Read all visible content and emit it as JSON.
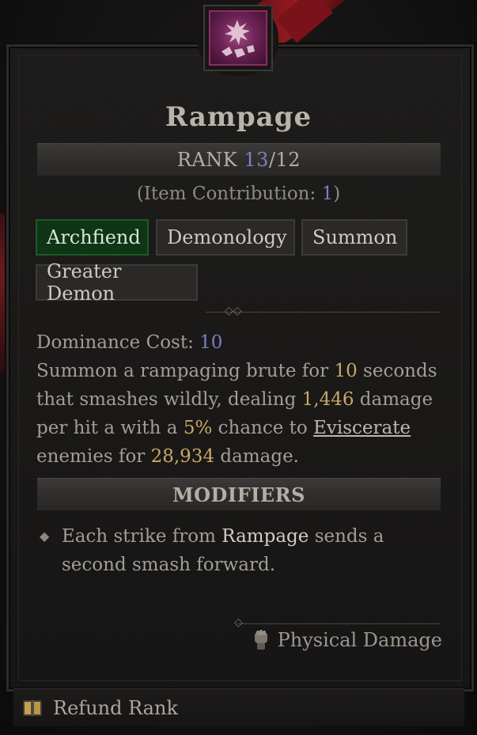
{
  "skill": {
    "name": "Rampage",
    "icon": "rampage-skill-icon",
    "rank_prefix": "RANK",
    "rank_current": "13",
    "rank_separator": "/",
    "rank_max": "12",
    "contribution_prefix": "(Item Contribution: ",
    "contribution_value": "1",
    "contribution_suffix": ")"
  },
  "tags": [
    {
      "label": "Archfiend",
      "active": true
    },
    {
      "label": "Demonology",
      "active": false
    },
    {
      "label": "Summon",
      "active": false
    },
    {
      "label": "Greater Demon",
      "active": false
    }
  ],
  "cost": {
    "label": "Dominance Cost: ",
    "value": "10"
  },
  "description": {
    "p1": "Summon a rampaging brute for ",
    "duration": "10",
    "p2": " seconds that smashes wildly, dealing ",
    "damage": "1,446",
    "p3": " damage per hit a with a ",
    "chance": "5%",
    "p4": " chance to ",
    "keyword": "Eviscerate",
    "p5": " enemies for ",
    "evis_damage": "28,934",
    "p6": " damage."
  },
  "modifiers": {
    "header": "MODIFIERS",
    "items": [
      {
        "pre": "Each strike from ",
        "highlight": "Rampage",
        "post": " sends a second smash forward."
      }
    ]
  },
  "damage_type": {
    "label": "Physical Damage",
    "icon": "fist-icon"
  },
  "refund": {
    "label": "Refund Rank",
    "icon": "book-icon"
  },
  "colors": {
    "highlight_number": "#c8a867",
    "rank_number": "#7b7fc4",
    "active_tag": "#0e3515"
  }
}
